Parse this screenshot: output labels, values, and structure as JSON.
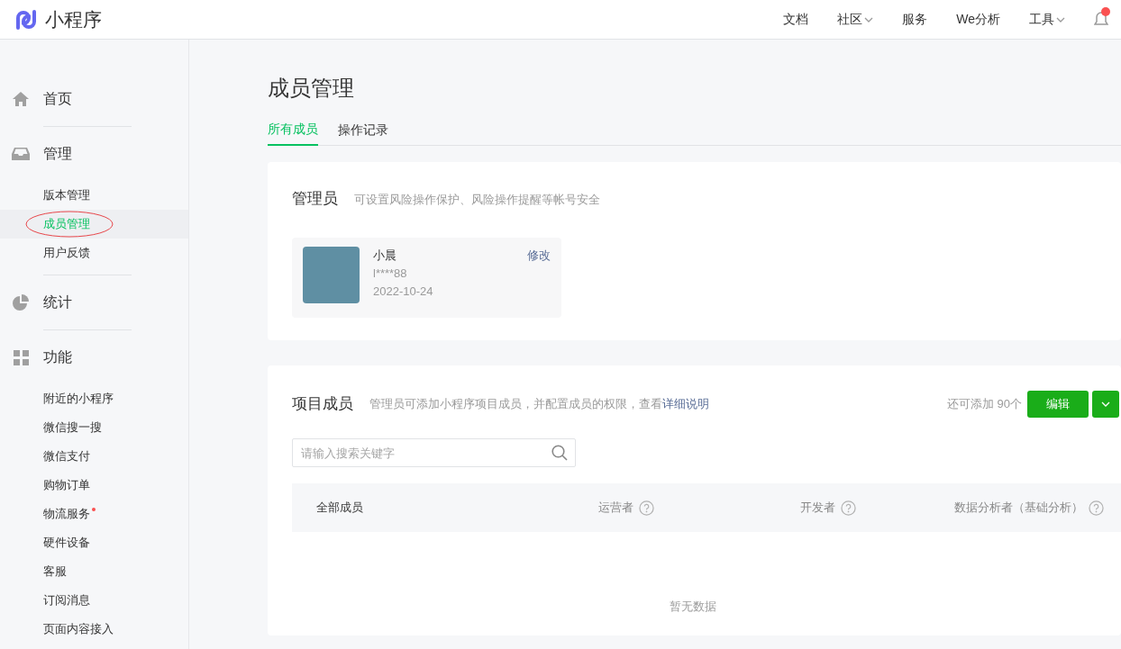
{
  "header": {
    "logo_text": "小程序",
    "nav": [
      {
        "label": "文档",
        "dropdown": false
      },
      {
        "label": "社区",
        "dropdown": true
      },
      {
        "label": "服务",
        "dropdown": false
      },
      {
        "label": "We分析",
        "dropdown": false
      },
      {
        "label": "工具",
        "dropdown": true
      }
    ],
    "notification_badge": true
  },
  "sidebar": {
    "groups": [
      {
        "title": "首页"
      },
      {
        "title": "管理",
        "items": [
          {
            "label": "版本管理",
            "selected": false,
            "dot": false
          },
          {
            "label": "成员管理",
            "selected": true,
            "dot": false
          },
          {
            "label": "用户反馈",
            "selected": false,
            "dot": false
          }
        ]
      },
      {
        "title": "统计"
      },
      {
        "title": "功能",
        "items": [
          {
            "label": "附近的小程序",
            "selected": false,
            "dot": false
          },
          {
            "label": "微信搜一搜",
            "selected": false,
            "dot": false
          },
          {
            "label": "微信支付",
            "selected": false,
            "dot": false
          },
          {
            "label": "购物订单",
            "selected": false,
            "dot": false
          },
          {
            "label": "物流服务",
            "selected": false,
            "dot": true
          },
          {
            "label": "硬件设备",
            "selected": false,
            "dot": false
          },
          {
            "label": "客服",
            "selected": false,
            "dot": false
          },
          {
            "label": "订阅消息",
            "selected": false,
            "dot": false
          },
          {
            "label": "页面内容接入",
            "selected": false,
            "dot": false
          }
        ]
      }
    ]
  },
  "page": {
    "title": "成员管理",
    "tabs": [
      {
        "label": "所有成员",
        "selected": true
      },
      {
        "label": "操作记录",
        "selected": false
      }
    ],
    "admin_card": {
      "title": "管理员",
      "subtitle": "可设置风险操作保护、风险操作提醒等帐号安全",
      "admin": {
        "name": "小晨",
        "account": "l****88",
        "date": "2022-10-24",
        "action": "修改"
      }
    },
    "members_card": {
      "title": "项目成员",
      "description": "管理员可添加小程序项目成员，并配置成员的权限，查看",
      "link": "详细说明",
      "quota": "还可添加 90个",
      "edit_button": "编辑",
      "search": {
        "placeholder": "请输入搜索关键字"
      },
      "columns": [
        {
          "label": "全部成员",
          "help": false
        },
        {
          "label": "运营者",
          "help": true
        },
        {
          "label": "开发者",
          "help": true
        },
        {
          "label": "数据分析者（基础分析）",
          "help": true
        }
      ],
      "empty_text": "暂无数据"
    }
  }
}
